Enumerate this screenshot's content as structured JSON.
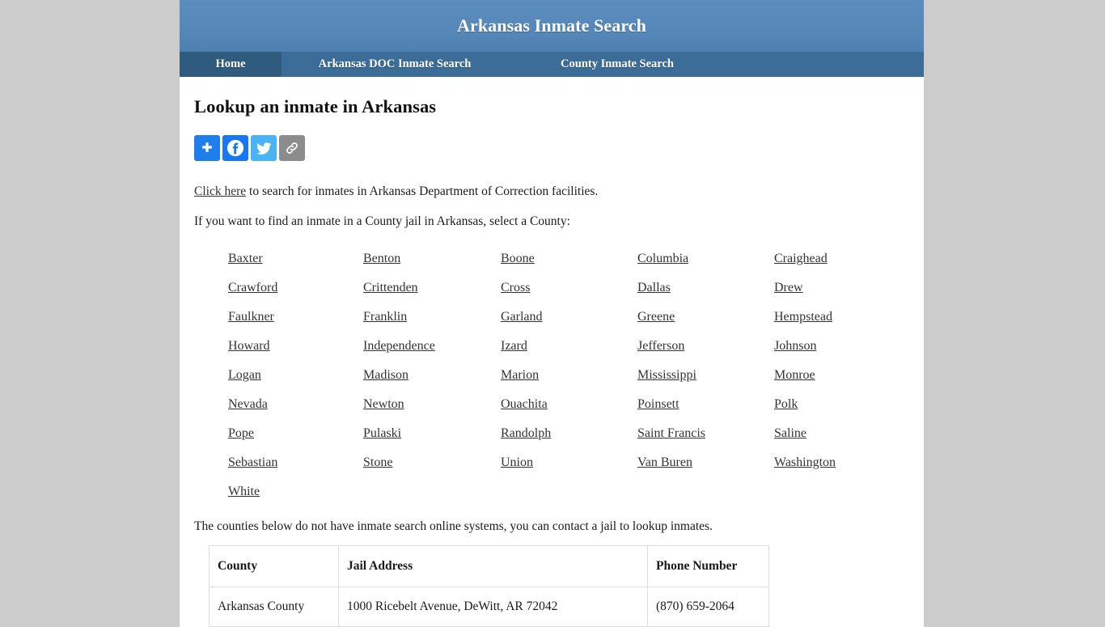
{
  "site": {
    "title": "Arkansas Inmate Search",
    "header_color": "#5688ba",
    "nav_color": "#3c6d99",
    "nav_active_color": "#2e5b7e",
    "page_background": "#cccccc"
  },
  "nav": {
    "items": [
      {
        "label": "Home",
        "active": true
      },
      {
        "label": "Arkansas DOC Inmate Search",
        "active": false
      },
      {
        "label": "County Inmate Search",
        "active": false
      }
    ]
  },
  "main": {
    "heading": "Lookup an inmate in Arkansas",
    "share": {
      "buttons": [
        {
          "name": "addthis-share-button",
          "icon": "plus-icon",
          "color": "#1f7fea"
        },
        {
          "name": "facebook-share-button",
          "icon": "facebook-icon",
          "color": "#1877f2"
        },
        {
          "name": "twitter-share-button",
          "icon": "twitter-icon",
          "color": "#4ab3f4"
        },
        {
          "name": "copy-link-share-button",
          "icon": "chain-link-icon",
          "color": "#8c8c8c"
        }
      ]
    },
    "intro_doc": {
      "link_text": "Click here",
      "rest_text": " to search for inmates in Arkansas Department of Correction facilities."
    },
    "intro_county": "If you want to find an inmate in a County jail in Arkansas, select a County:",
    "counties": [
      "Baxter",
      "Benton",
      "Boone",
      "Columbia",
      "Craighead",
      "Crawford",
      "Crittenden",
      "Cross",
      "Dallas",
      "Drew",
      "Faulkner",
      "Franklin",
      "Garland",
      "Greene",
      "Hempstead",
      "Howard",
      "Independence",
      "Izard",
      "Jefferson",
      "Johnson",
      "Logan",
      "Madison",
      "Marion",
      "Mississippi",
      "Monroe",
      "Nevada",
      "Newton",
      "Ouachita",
      "Poinsett",
      "Polk",
      "Pope",
      "Pulaski",
      "Randolph",
      "Saint Francis",
      "Saline",
      "Sebastian",
      "Stone",
      "Union",
      "Van Buren",
      "Washington",
      "White"
    ],
    "table_note": "The counties below do not have inmate search online systems, you can contact a jail to lookup inmates.",
    "table": {
      "headers": [
        "County",
        "Jail Address",
        "Phone Number"
      ],
      "rows": [
        [
          "Arkansas County",
          "1000 Ricebelt Avenue, DeWitt, AR 72042",
          "(870) 659-2064"
        ]
      ]
    }
  }
}
